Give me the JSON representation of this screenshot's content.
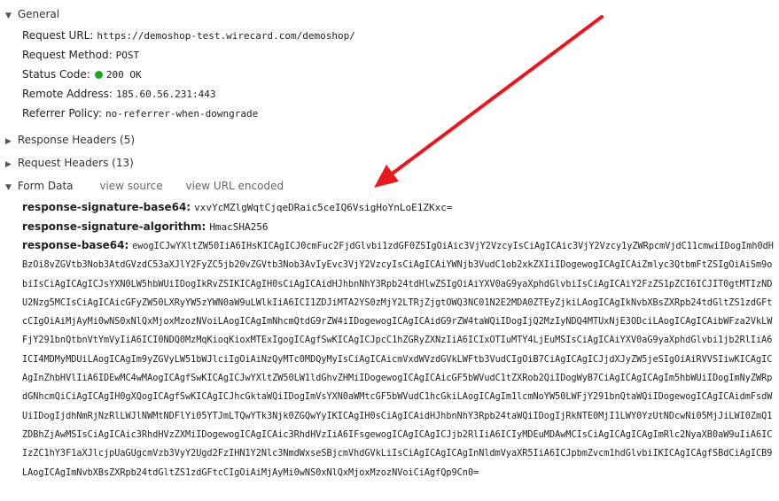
{
  "general": {
    "title": "General",
    "request_url_label": "Request URL:",
    "request_url": "https://demoshop-test.wirecard.com/demoshop/",
    "request_method_label": "Request Method:",
    "request_method": "POST",
    "status_code_label": "Status Code:",
    "status_code": "200 OK",
    "remote_address_label": "Remote Address:",
    "remote_address": "185.60.56.231:443",
    "referrer_policy_label": "Referrer Policy:",
    "referrer_policy": "no-referrer-when-downgrade"
  },
  "response_headers": {
    "title": "Response Headers (5)"
  },
  "request_headers": {
    "title": "Request Headers (13)"
  },
  "form_data": {
    "title": "Form Data",
    "view_source": "view source",
    "view_url_encoded": "view URL encoded",
    "sig_label": "response-signature-base64:",
    "sig_value": "vxvYcMZlgWqtCjqeDRaic5ceIQ6VsigHoYnLoE1ZKxc=",
    "alg_label": "response-signature-algorithm:",
    "alg_value": "HmacSHA256",
    "b64_label": "response-base64:",
    "b64_value": "ewogICJwYXltZW50IiA6IHsKICAgICJ0cmFuc2FjdGlvbi1zdGF0ZSIgOiAic3VjY2VzcyIsCiAgICAic3VjY2Vzcy1yZWRpcmVjdC11cmwiIDogImh0dHBzOi8vZGVtb3Nob3AtdGVzdC53aXJlY2FyZC5jb20vZGVtb3Nob3AvIyEvc3VjY2VzcyIsCiAgICAiYWNjb3VudC1ob2xkZXIiIDogewogICAgICAiZmlyc3QtbmFtZSIgOiAiSm9obiIsCiAgICAgICJsYXN0LW5hbWUiIDogIkRvZSIKICAgIH0sCiAgICAidHJhbnNhY3Rpb24tdHlwZSIgOiAiYXV0aG9yaXphdGlvbiIsCiAgICAiY2FzZS1pZCI6ICJIT0gtMTIzNDU2Nzg5MCIsCiAgICAicGFyZW50LXRyYW5zYWN0aW9uLWlkIiA6ICI1ZDJiMTA2YS0zMjY2LTRjZjgtOWQ3NC01N2E2MDA0ZTEyZjkiLAogICAgIkNvbXBsZXRpb24tdGltZS1zdGFtcCIgOiAiMjAyMi0wNS0xNlQxMjoxMzozNVoiLAogICAgImNhcmQtdG9rZW4iIDogewogICAgICAidG9rZW4taWQiIDogIjQ2MzIyNDQ4MTUxNjE3ODciLAogICAgICAibWFza2VkLWFjY291bnQtbnVtYmVyIiA6ICI0NDQ0MzMqKioqKioxMTExIgogICAgfSwKICAgICJpcC1hZGRyZXNzIiA6ICIxOTIuMTY4LjEuMSIsCiAgICAiYXV0aG9yaXphdGlvbi1jb2RlIiA6ICI4MDMyMDUiLAogICAgIm9yZGVyLW51bWJlciIgOiAiNzQyMTc0MDQyMyIsCiAgICAicmVxdWVzdGVkLWFtb3VudCIgOiB7CiAgICAgICJjdXJyZW5jeSIgOiAiRVVSIiwKICAgICAgInZhbHVlIiA6IDEwMC4wMAogICAgfSwKICAgICJwYXltZW50LW1ldGhvZHMiIDogewogICAgICAicGF5bWVudC1tZXRob2QiIDogWyB7CiAgICAgICAgIm5hbWUiIDogImNyZWRpdGNhcmQiCiAgICAgIH0gXQogICAgfSwKICAgICJhcGktaWQiIDogImVsYXN0aWMtcGF5bWVudC1hcGkiLAogICAgIm1lcmNoYW50LWFjY291bnQtaWQiIDogewogICAgICAidmFsdWUiIDogIjdhNmRjNzRlLWJlNWMtNDFlYi05YTJmLTQwYTk3Njk0ZGQwYyIKICAgIH0sCiAgICAidHJhbnNhY3Rpb24taWQiIDogIjRkNTE0MjI1LWY0YzUtNDcwNi05MjJiLWI0ZmQ1ZDBhZjAwMSIsCiAgICAic3RhdHVzZXMiIDogewogICAgICAic3RhdHVzIiA6IFsgewogICAgICAgICJjb2RlIiA6ICIyMDEuMDAwMCIsCiAgICAgICAgImRlc2NyaXB0aW9uIiA6ICIzZC1hY3F1aXJlcjpUaGUgcmVzb3VyY2Ugd2FzIHN1Y2Nlc3NmdWxseSBjcmVhdGVkLiIsCiAgICAgICAgInNldmVyaXR5IiA6ICJpbmZvcm1hdGlvbiIKICAgICAgfSBdCiAgICB9LAogICAgImNvbXBsZXRpb24tdGltZS1zdGFtcCIgOiAiMjAyMi0wNS0xNlQxMjoxMzozNVoiCiAgfQp9Cn0="
  },
  "colors": {
    "arrow": "#e8191d",
    "status_ok": "#1aab1a"
  }
}
